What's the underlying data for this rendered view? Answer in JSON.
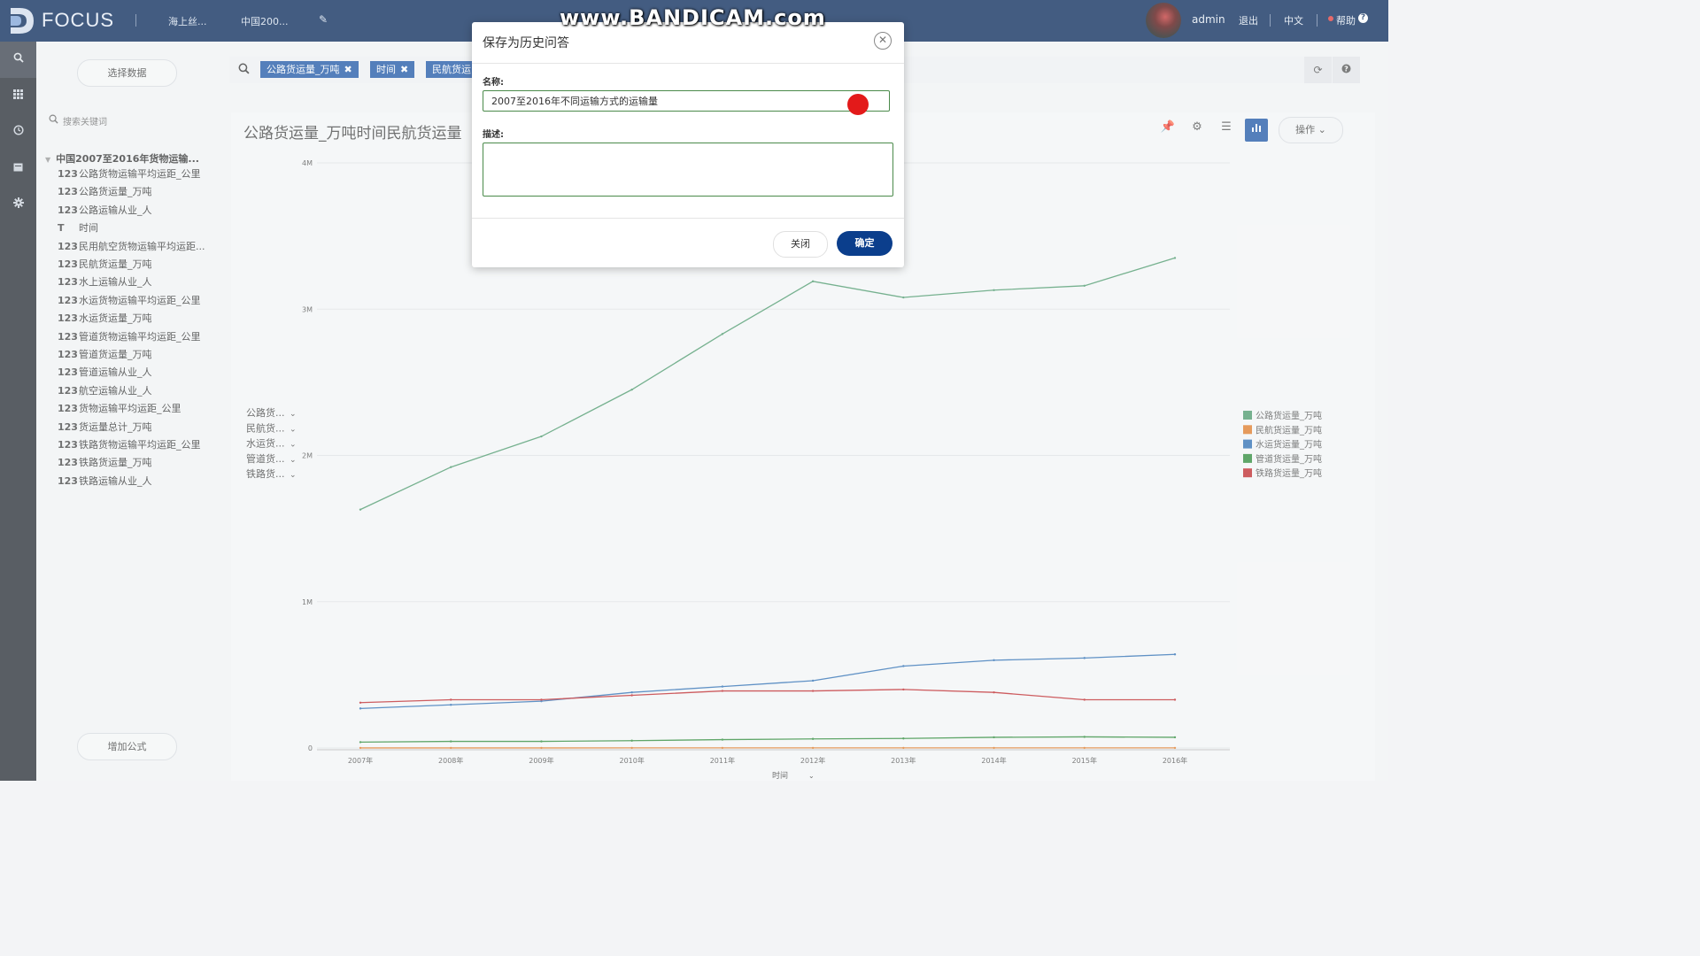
{
  "watermark": "www.BANDICAM.com",
  "topbar": {
    "brand": "FOCUS",
    "tabs": [
      "海上丝...",
      "中国200..."
    ],
    "user": "admin",
    "logout": "退出",
    "lang": "中文",
    "help": "帮助"
  },
  "sidebar": {
    "select_data": "选择数据",
    "search_placeholder": "搜索关键词",
    "table_name": "中国2007至2016年货物运输...",
    "fields": [
      {
        "type": "123",
        "name": "公路货物运输平均运距_公里"
      },
      {
        "type": "123",
        "name": "公路货运量_万吨"
      },
      {
        "type": "123",
        "name": "公路运输从业_人"
      },
      {
        "type": "T",
        "name": "时间"
      },
      {
        "type": "123",
        "name": "民用航空货物运输平均运距..."
      },
      {
        "type": "123",
        "name": "民航货运量_万吨"
      },
      {
        "type": "123",
        "name": "水上运输从业_人"
      },
      {
        "type": "123",
        "name": "水运货物运输平均运距_公里"
      },
      {
        "type": "123",
        "name": "水运货运量_万吨"
      },
      {
        "type": "123",
        "name": "管道货物运输平均运距_公里"
      },
      {
        "type": "123",
        "name": "管道货运量_万吨"
      },
      {
        "type": "123",
        "name": "管道运输从业_人"
      },
      {
        "type": "123",
        "name": "航空运输从业_人"
      },
      {
        "type": "123",
        "name": "货物运输平均运距_公里"
      },
      {
        "type": "123",
        "name": "货运量总计_万吨"
      },
      {
        "type": "123",
        "name": "铁路货物运输平均运距_公里"
      },
      {
        "type": "123",
        "name": "铁路货运量_万吨"
      },
      {
        "type": "123",
        "name": "铁路运输从业_人"
      }
    ],
    "add_formula": "增加公式"
  },
  "query": {
    "chips": [
      "公路货运量_万吨",
      "时间",
      "民航货运"
    ]
  },
  "chart_panel": {
    "title": "公路货运量_万吨时间民航货运量",
    "operate": "操作",
    "series_selectors": [
      "公路货...",
      "民航货...",
      "水运货...",
      "管道货...",
      "铁路货..."
    ]
  },
  "chart_data": {
    "type": "line",
    "x": [
      "2007年",
      "2008年",
      "2009年",
      "2010年",
      "2011年",
      "2012年",
      "2013年",
      "2014年",
      "2015年",
      "2016年"
    ],
    "xlabel": "时间",
    "ylim": [
      0,
      4000000
    ],
    "yticks": [
      "0",
      "1M",
      "2M",
      "3M",
      "4M"
    ],
    "grid": true,
    "legend_position": "right",
    "series": [
      {
        "name": "公路货运量_万吨",
        "color": "#4c9a6d",
        "values": [
          1630000,
          1920000,
          2130000,
          2450000,
          2830000,
          3190000,
          3080000,
          3130000,
          3160000,
          3350000
        ]
      },
      {
        "name": "民航货运量_万吨",
        "color": "#e07b29",
        "values": [
          400,
          410,
          450,
          560,
          560,
          550,
          560,
          590,
          630,
          670
        ]
      },
      {
        "name": "水运货运量_万吨",
        "color": "#2e6fb5",
        "values": [
          270000,
          295000,
          320000,
          380000,
          420000,
          460000,
          560000,
          600000,
          615000,
          640000
        ]
      },
      {
        "name": "管道货运量_万吨",
        "color": "#2e8b3a",
        "values": [
          40000,
          45000,
          45000,
          50000,
          57000,
          62000,
          65000,
          73000,
          76000,
          73000
        ]
      },
      {
        "name": "铁路货运量_万吨",
        "color": "#c0282d",
        "values": [
          310000,
          330000,
          330000,
          360000,
          390000,
          390000,
          400000,
          380000,
          330000,
          330000
        ]
      }
    ]
  },
  "modal": {
    "title": "保存为历史问答",
    "name_label": "名称:",
    "name_value": "2007至2016年不同运输方式的运输量",
    "desc_label": "描述:",
    "desc_value": "",
    "close_button": "关闭",
    "ok_button": "确定"
  },
  "colors": {
    "topbar": "#08295a",
    "primary": "#1f57a7",
    "ok_button": "#0b3e8c"
  }
}
